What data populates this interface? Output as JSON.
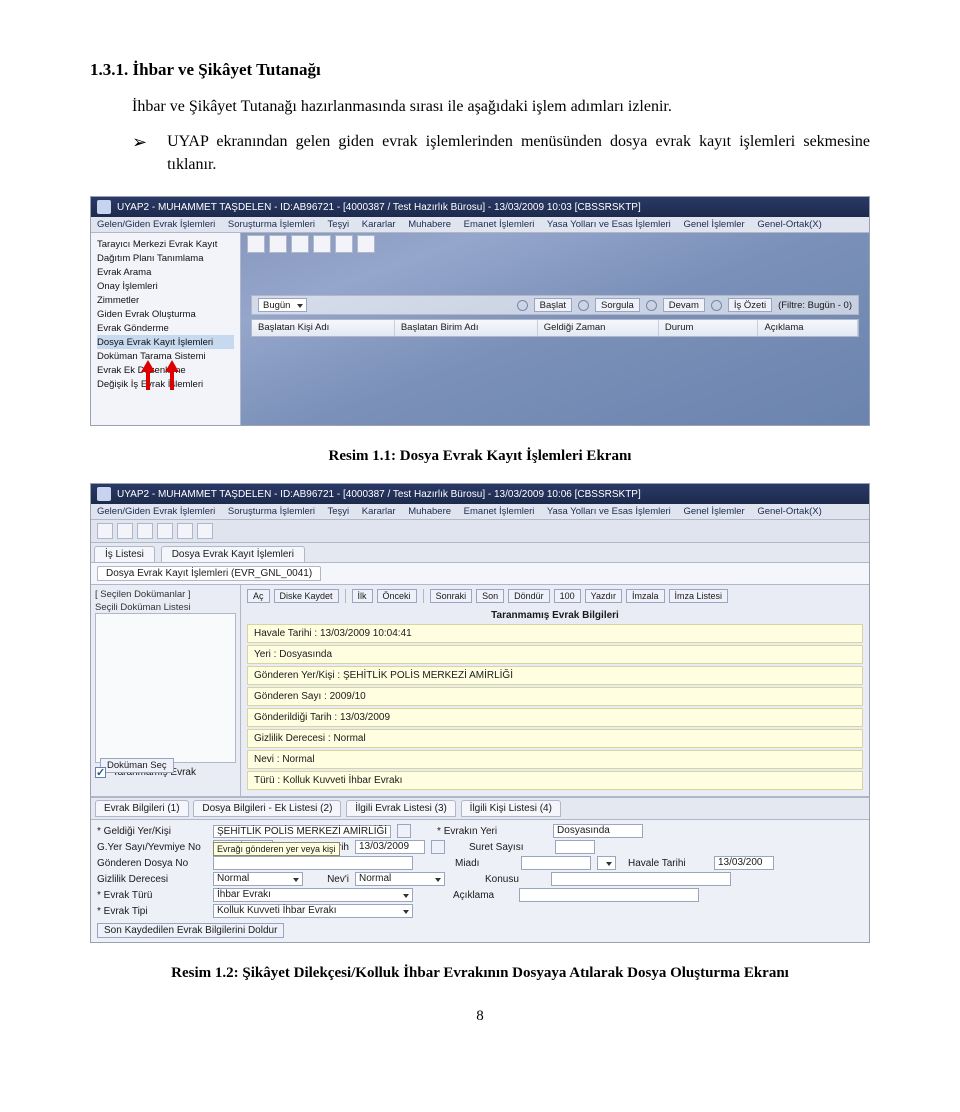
{
  "doc": {
    "heading": "1.3.1. İhbar ve Şikâyet Tutanağı",
    "para1": "İhbar ve Şikâyet Tutanağı hazırlanmasında sırası ile aşağıdaki işlem adımları izlenir.",
    "bullet_mark": "➢",
    "bullet1": "UYAP ekranından gelen giden evrak işlemlerinden menüsünden dosya evrak kayıt işlemleri sekmesine tıklanır.",
    "caption1": "Resim 1.1: Dosya Evrak Kayıt İşlemleri Ekranı",
    "caption2": "Resim 1.2: Şikâyet Dilekçesi/Kolluk İhbar Evrakının Dosyaya Atılarak Dosya Oluşturma Ekranı",
    "pagenum": "8"
  },
  "s1": {
    "title": "UYAP2 - MUHAMMET TAŞDELEN - ID:AB96721 - [4000387 / Test Hazırlık Bürosu] - 13/03/2009 10:03 [CBSSRSKTP]",
    "menu": [
      "Gelen/Giden Evrak İşlemleri",
      "Soruşturma İşlemleri",
      "Teşyi",
      "Kararlar",
      "Muhabere",
      "Emanet İşlemleri",
      "Yasa Yolları ve Esas İşlemleri",
      "Genel İşlemler",
      "Genel-Ortak(X)"
    ],
    "side": [
      "Tarayıcı Merkezi Evrak Kayıt",
      "Dağıtım Planı Tanımlama",
      "Evrak Arama",
      "Onay İşlemleri",
      "Zimmetler",
      "Giden Evrak Oluşturma",
      "Evrak Gönderme",
      "Dosya Evrak Kayıt İşlemleri",
      "Doküman Tarama Sistemi",
      "Evrak Ek Düzenleme",
      "Değişik İş Evrak İşlemleri"
    ],
    "filter": {
      "sel": "Bugün",
      "b1": "Başlat",
      "b2": "Sorgula",
      "b3": "Devam",
      "b4": "İş Özeti",
      "lab": "(Filtre: Bugün - 0)"
    },
    "grid": [
      "Başlatan Kişi Adı",
      "Başlatan Birim Adı",
      "Geldiği Zaman",
      "Durum",
      "Açıklama"
    ]
  },
  "s2": {
    "title": "UYAP2 - MUHAMMET TAŞDELEN - ID:AB96721 - [4000387 / Test Hazırlık Bürosu] - 13/03/2009 10:06 [CBSSRSKTP]",
    "menu": [
      "Gelen/Giden Evrak İşlemleri",
      "Soruşturma İşlemleri",
      "Teşyi",
      "Kararlar",
      "Muhabere",
      "Emanet İşlemleri",
      "Yasa Yolları ve Esas İşlemleri",
      "Genel İşlemler",
      "Genel-Ortak(X)"
    ],
    "tabs": [
      "İş Listesi",
      "Dosya Evrak Kayıt İşlemleri"
    ],
    "subtab": "Dosya Evrak Kayıt İşlemleri (EVR_GNL_0041)",
    "left": {
      "group": "[ Seçilen Dokümanlar ]",
      "listlab": "Seçili Doküman Listesi",
      "btn": "Doküman Seç"
    },
    "toolbar": [
      "Aç",
      "Diske Kaydet",
      "İlk",
      "Önceki",
      "Sonraki",
      "Son",
      "Döndür",
      "100",
      "Yazdır",
      "İmzala",
      "İmza Listesi"
    ],
    "panel_title": "Taranmamış Evrak Bilgileri",
    "fields": [
      "Havale Tarihi : 13/03/2009 10:04:41",
      "Yeri : Dosyasında",
      "Gönderen Yer/Kişi : ŞEHİTLİK POLİS MERKEZİ AMİRLİĞİ",
      "Gönderen Sayı : 2009/10",
      "Gönderildiği Tarih : 13/03/2009",
      "Gizlilik Derecesi : Normal",
      "Nevi : Normal",
      "Türü : Kolluk Kuvveti İhbar Evrakı"
    ],
    "chk": "Taranmamış Evrak",
    "bottomtabs": [
      "Evrak Bilgileri (1)",
      "Dosya Bilgileri - Ek Listesi (2)",
      "İlgili Evrak Listesi (3)",
      "İlgili Kişi Listesi (4)"
    ],
    "form": {
      "l_geldigi": "Geldiği Yer/Kişi",
      "v_geldigi": "ŞEHİTLİK POLİS MERKEZİ AMİRLİĞİ",
      "l_evrakin_yeri": "Evrakın Yeri",
      "v_evrakin_yeri": "Dosyasında",
      "l_gyer": "G.Yer Sayı/Yevmiye No",
      "v_gyer": "2009/10",
      "l_gyt": "G.Yer Tarih",
      "v_gyt": "13/03/2009",
      "l_suret": "Suret Sayısı",
      "l_gonderen": "Gönderen Dosya No",
      "l_miadi": "Miadı",
      "l_havale": "Havale Tarihi",
      "v_havale": "13/03/200",
      "l_gizlilik": "Gizlilik Derecesi",
      "v_gizlilik": "Normal",
      "l_nevi": "Nev'i",
      "v_nevi": "Normal",
      "l_konusu": "Konusu",
      "l_evrakturu": "Evrak Türü",
      "v_evrakturu": "İhbar Evrakı",
      "l_aciklama": "Açıklama",
      "l_evraktipi": "Evrak Tipi",
      "v_evraktipi": "Kolluk Kuvveti İhbar Evrakı",
      "tooltip": "Evrağı gönderen yer veya kişi",
      "footbtn": "Son Kaydedilen Evrak Bilgilerini Doldur"
    }
  }
}
